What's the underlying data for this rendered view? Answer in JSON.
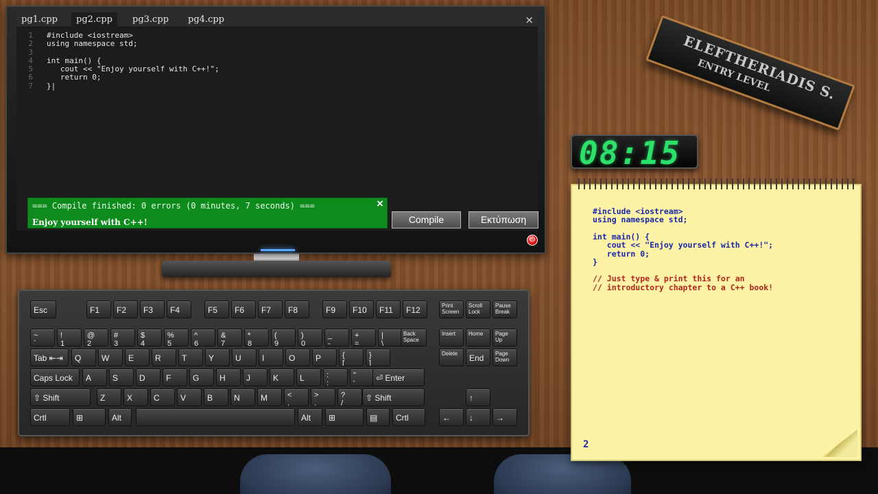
{
  "editor": {
    "tabs": [
      "pg1.cpp",
      "pg2.cpp",
      "pg3.cpp",
      "pg4.cpp"
    ],
    "active_tab": "pg2.cpp",
    "close_glyph": "×",
    "code": [
      {
        "n": "1",
        "text": "#include <iostream>"
      },
      {
        "n": "2",
        "text": "using namespace std;"
      },
      {
        "n": "3",
        "text": ""
      },
      {
        "n": "4",
        "text": "int main() {"
      },
      {
        "n": "5",
        "text": "   cout << \"Enjoy yourself with C++!\";"
      },
      {
        "n": "6",
        "text": "   return 0;"
      },
      {
        "n": "7",
        "text": "}|"
      }
    ],
    "compile_status": "=== Compile finished: 0 errors (0 minutes, 7 seconds) ===",
    "compile_output": "Enjoy yourself with C++!",
    "compile_close": "×",
    "compile_button": "Compile",
    "print_button": "Εκτύπωση",
    "power_glyph": "⏻"
  },
  "nameplate": {
    "name": "ELEFTHERIADIS S.",
    "level": "ENTRY LEVEL"
  },
  "clock": {
    "time": "08:15"
  },
  "notepad": {
    "lines": [
      {
        "text": "#include <iostream>",
        "color": "#1a2aa8"
      },
      {
        "text": "using namespace std;",
        "color": "#1a2aa8"
      },
      {
        "text": "",
        "color": "#1a2aa8"
      },
      {
        "text": "int main() {",
        "color": "#1a2aa8"
      },
      {
        "text": "   cout << \"Enjoy yourself with C++!\";",
        "color": "#1a2aa8"
      },
      {
        "text": "   return 0;",
        "color": "#1a2aa8"
      },
      {
        "text": "}",
        "color": "#1a2aa8"
      },
      {
        "text": "",
        "color": "#1a2aa8"
      },
      {
        "text": "// Just type & print this for an",
        "color": "#b0261c"
      },
      {
        "text": "// introductory chapter to a C++ book!",
        "color": "#b0261c"
      }
    ],
    "page_number": "2"
  },
  "keyboard": {
    "keys": [
      "Esc",
      "F1",
      "F2",
      "F3",
      "F4",
      "F5",
      "F6",
      "F7",
      "F8",
      "F9",
      "F10",
      "F11",
      "F12",
      "Print\nScreen",
      "Scroll\nLock",
      "Pause\nBreak",
      "~\n`",
      "!\n1",
      "@\n2",
      "#\n3",
      "$\n4",
      "%\n5",
      "^\n6",
      "&\n7",
      "*\n8",
      "(\n9",
      ")\n0",
      "_\n-",
      "+\n=",
      "|\n\\",
      "Back\nSpace",
      "Insert",
      "Home",
      "Page\nUp",
      "Tab ⇤⇥",
      "Q",
      "W",
      "E",
      "R",
      "T",
      "Y",
      "U",
      "I",
      "O",
      "P",
      "{\n[",
      "}\n]",
      "Delete",
      "End",
      "Page\nDown",
      "Caps Lock",
      "A",
      "S",
      "D",
      "F",
      "G",
      "H",
      "J",
      "K",
      "L",
      ":\n;",
      "\"\n'",
      "⏎ Enter",
      "⇧ Shift",
      "Z",
      "X",
      "C",
      "V",
      "B",
      "N",
      "M",
      "<\n,",
      ">\n.",
      "?\n/",
      "⇧ Shift",
      "↑",
      "Crtl",
      "⊞",
      "Alt",
      "",
      "Alt",
      "⊞",
      "▤",
      "Crtl",
      "←",
      "↓",
      "→"
    ]
  }
}
